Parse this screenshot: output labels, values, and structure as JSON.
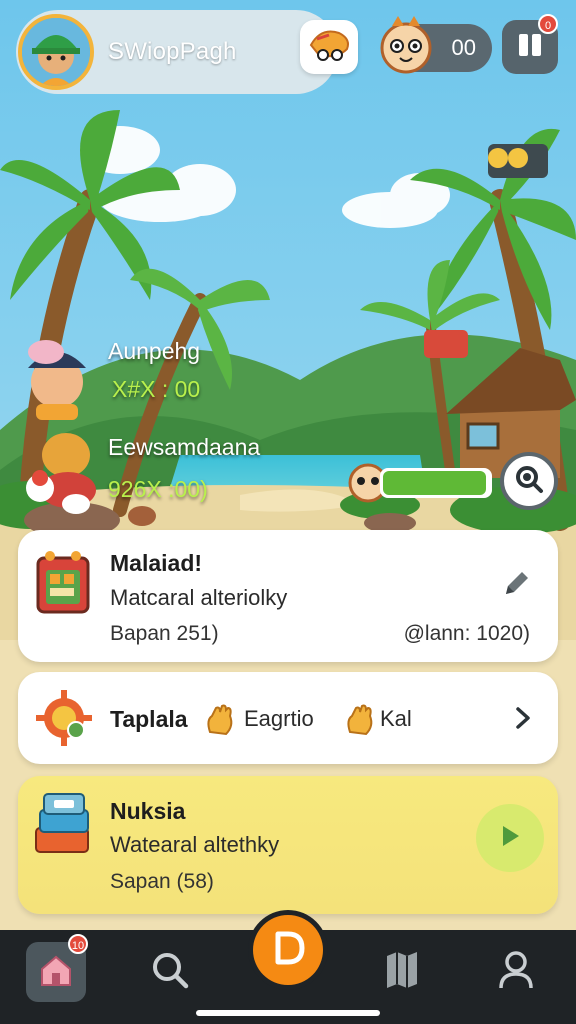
{
  "header": {
    "player_name": "SWiopPagh",
    "coin_value": "00",
    "map_badge": "0"
  },
  "scene": {
    "entry1": {
      "label": "Aunpehg",
      "score": "X#X : 00"
    },
    "entry2": {
      "label": "Eewsamdaana",
      "score": "926X :00)"
    },
    "progress_fraction": 0.97
  },
  "cards": [
    {
      "title": "Malaiad!",
      "subtitle": "Matcaral alteriolky",
      "meta_left": "Bapan 251)",
      "meta_right": "@lann: 1020)"
    },
    {
      "title": "Taplala",
      "text_a": "Eagrtio",
      "text_b": "Kal"
    },
    {
      "title": "Nuksia",
      "subtitle": "Watearal altethky",
      "meta_left": "Sapan (58)"
    }
  ],
  "nav": {
    "home_badge": "10"
  },
  "colors": {
    "accent_orange": "#f58a13",
    "progress_green": "#5fb936",
    "score_green": "#b9f04c",
    "card_yellow": "#f4e27a",
    "nav_dark": "#1f2326"
  },
  "icons": [
    "avatar",
    "menu-tile-icon",
    "coin-mascot-icon",
    "map-icon",
    "search-icon",
    "pencil-icon",
    "chevron-right-icon",
    "play-icon",
    "home-icon",
    "logo-icon",
    "user-icon"
  ]
}
